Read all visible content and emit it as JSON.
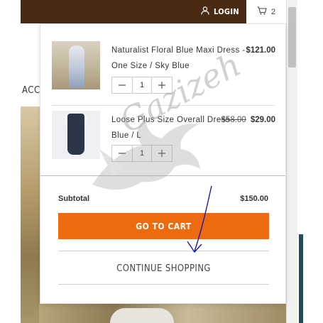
{
  "header": {
    "login_label": "LOGIN",
    "cart_count": "2",
    "partial_nav_text": "ACC"
  },
  "minicart": {
    "items": [
      {
        "name": "Naturalist Floral Blue Maxi Dress - One Size / Sky Blue",
        "price": "$121.00",
        "old_price": "",
        "quantity": "1"
      },
      {
        "name": "Loose Plus Size Overall Dress - Blue / L",
        "price": "$29.00",
        "old_price": "$58.00",
        "quantity": "1"
      }
    ],
    "subtotal_label": "Subtotal",
    "subtotal_value": "$150.00",
    "go_to_cart_label": "GO TO CART",
    "continue_label": "CONTINUE SHOPPING"
  },
  "watermark": {
    "text": "Gazizeh"
  },
  "colors": {
    "topbar": "#4a2a12",
    "accent_button": "#ee6a0e",
    "annotation_arrow": "#1a1aa8"
  }
}
